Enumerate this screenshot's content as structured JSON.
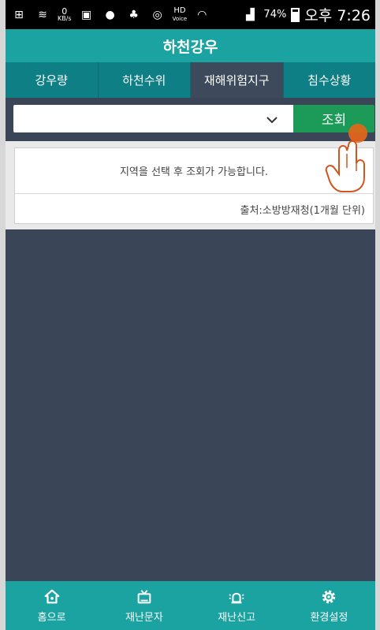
{
  "statusbar": {
    "netspeed_value": "0",
    "netspeed_unit": "KB/s",
    "battery": "74%",
    "time": "오후 7:26",
    "hd_label": "HD",
    "voice_label": "Voice"
  },
  "app": {
    "title": "하천강우"
  },
  "tabs": [
    {
      "label": "강우량",
      "active": false
    },
    {
      "label": "하천수위",
      "active": false
    },
    {
      "label": "재해위험지구",
      "active": true
    },
    {
      "label": "침수상황",
      "active": false
    }
  ],
  "search": {
    "select_value": "",
    "button_label": "조회"
  },
  "result": {
    "message": "지역을 선택 후 조회가 가능합니다.",
    "source": "출처:소방방재청(1개월 단위)"
  },
  "bottom_nav": [
    {
      "label": "홈으로",
      "icon": "home-icon"
    },
    {
      "label": "재난문자",
      "icon": "tv-icon"
    },
    {
      "label": "재난신고",
      "icon": "siren-icon"
    },
    {
      "label": "환경설정",
      "icon": "gear-icon"
    }
  ],
  "colors": {
    "teal": "#1aa3a0",
    "tab_bg": "#0f7f86",
    "active_tab": "#3c4a5b",
    "body_bg": "#3a4557",
    "green_button": "#1b9b57"
  }
}
